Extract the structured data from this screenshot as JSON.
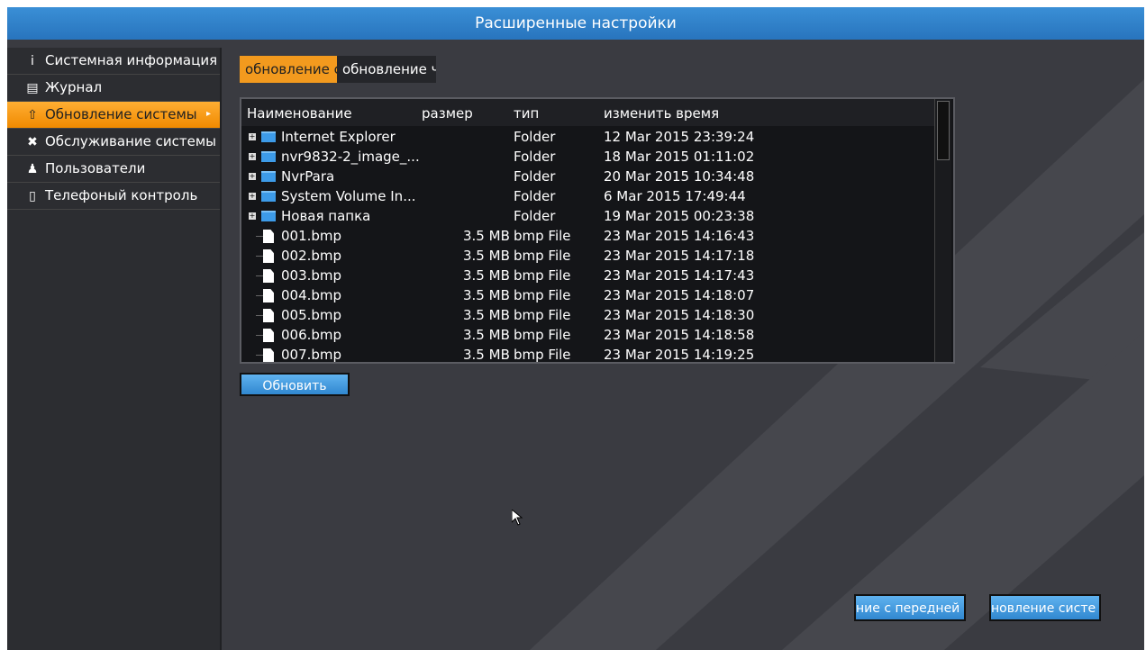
{
  "window": {
    "title": "Расширенные настройки"
  },
  "sidebar": {
    "items": [
      {
        "icon": "info-icon",
        "glyph": "i",
        "label": "Системная информация",
        "active": false
      },
      {
        "icon": "journal-icon",
        "glyph": "▤",
        "label": "Журнал",
        "active": false
      },
      {
        "icon": "upload-icon",
        "glyph": "⇧",
        "label": "Обновление системы",
        "active": true
      },
      {
        "icon": "tools-icon",
        "glyph": "✖",
        "label": "Обслуживание системы",
        "active": false
      },
      {
        "icon": "user-icon",
        "glyph": "♟",
        "label": "Пользователи",
        "active": false
      },
      {
        "icon": "phone-icon",
        "glyph": "▯",
        "label": "Телефоный контроль",
        "active": false
      }
    ]
  },
  "tabs": [
    {
      "label": "обновление с",
      "active": true
    },
    {
      "label": "обновление ч",
      "active": false
    }
  ],
  "file_list": {
    "headers": {
      "name": "Наименование",
      "size": "размер",
      "type": "тип",
      "modified": "изменить время"
    },
    "rows": [
      {
        "kind": "folder",
        "name": "Internet Explorer",
        "size": "",
        "type": "Folder",
        "modified": "12 Mar 2015 23:39:24"
      },
      {
        "kind": "folder",
        "name": "nvr9832-2_image_...",
        "size": "",
        "type": "Folder",
        "modified": "18 Mar 2015 01:11:02"
      },
      {
        "kind": "folder",
        "name": "NvrPara",
        "size": "",
        "type": "Folder",
        "modified": "20 Mar 2015 10:34:48"
      },
      {
        "kind": "folder",
        "name": "System Volume In...",
        "size": "",
        "type": "Folder",
        "modified": "6 Mar 2015 17:49:44"
      },
      {
        "kind": "folder",
        "name": "Новая папка",
        "size": "",
        "type": "Folder",
        "modified": "19 Mar 2015 00:23:38"
      },
      {
        "kind": "file",
        "name": "001.bmp",
        "size": "3.5 MB",
        "type": "bmp File",
        "modified": "23 Mar 2015 14:16:43"
      },
      {
        "kind": "file",
        "name": "002.bmp",
        "size": "3.5 MB",
        "type": "bmp File",
        "modified": "23 Mar 2015 14:17:18"
      },
      {
        "kind": "file",
        "name": "003.bmp",
        "size": "3.5 MB",
        "type": "bmp File",
        "modified": "23 Mar 2015 14:17:43"
      },
      {
        "kind": "file",
        "name": "004.bmp",
        "size": "3.5 MB",
        "type": "bmp File",
        "modified": "23 Mar 2015 14:18:07"
      },
      {
        "kind": "file",
        "name": "005.bmp",
        "size": "3.5 MB",
        "type": "bmp File",
        "modified": "23 Mar 2015 14:18:30"
      },
      {
        "kind": "file",
        "name": "006.bmp",
        "size": "3.5 MB",
        "type": "bmp File",
        "modified": "23 Mar 2015 14:18:58"
      },
      {
        "kind": "file",
        "name": "007.bmp",
        "size": "3.5 MB",
        "type": "bmp File",
        "modified": "23 Mar 2015 14:19:25"
      }
    ]
  },
  "buttons": {
    "refresh": "Обновить",
    "front_update": "ние с передней",
    "system_update": "новление систе"
  },
  "colors": {
    "accent": "#f39a1e",
    "titlebar": "#2f80c8",
    "background": "#3a3b41"
  }
}
